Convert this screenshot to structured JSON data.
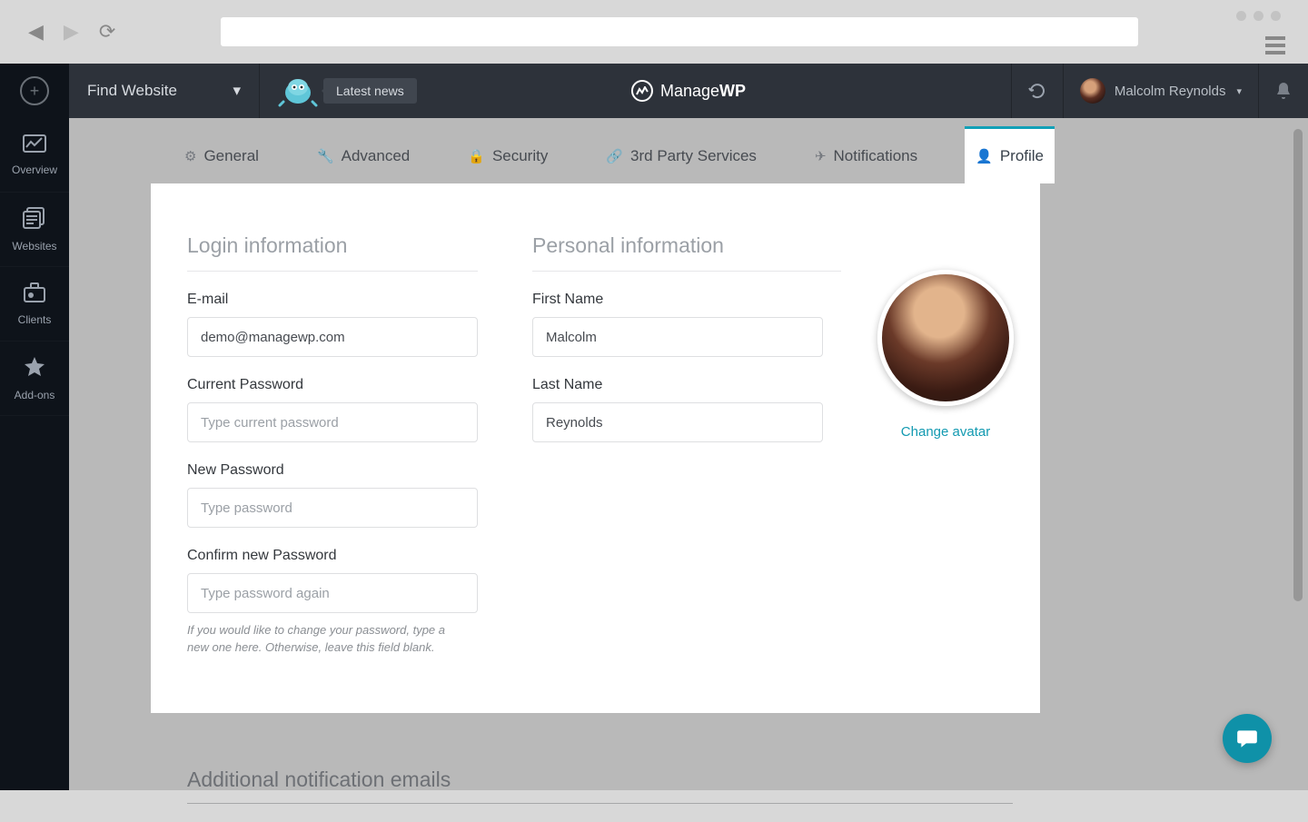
{
  "browser": {
    "url": ""
  },
  "sidebar": {
    "items": [
      {
        "label": "Overview"
      },
      {
        "label": "Websites"
      },
      {
        "label": "Clients"
      },
      {
        "label": "Add-ons"
      }
    ]
  },
  "header": {
    "find_website": "Find Website",
    "latest_news": "Latest news",
    "brand_prefix": "Manage",
    "brand_suffix": "WP",
    "user_name": "Malcolm Reynolds"
  },
  "tabs": [
    {
      "label": "General"
    },
    {
      "label": "Advanced"
    },
    {
      "label": "Security"
    },
    {
      "label": "3rd Party Services"
    },
    {
      "label": "Notifications"
    },
    {
      "label": "Profile"
    }
  ],
  "login": {
    "title": "Login information",
    "email_label": "E-mail",
    "email_value": "demo@managewp.com",
    "current_pw_label": "Current Password",
    "current_pw_placeholder": "Type current password",
    "new_pw_label": "New Password",
    "new_pw_placeholder": "Type password",
    "confirm_pw_label": "Confirm new Password",
    "confirm_pw_placeholder": "Type password again",
    "hint": "If you would like to change your password, type a new one here. Otherwise, leave this field blank."
  },
  "personal": {
    "title": "Personal information",
    "first_name_label": "First Name",
    "first_name_value": "Malcolm",
    "last_name_label": "Last Name",
    "last_name_value": "Reynolds",
    "change_avatar": "Change avatar"
  },
  "additional": {
    "title": "Additional notification emails"
  }
}
